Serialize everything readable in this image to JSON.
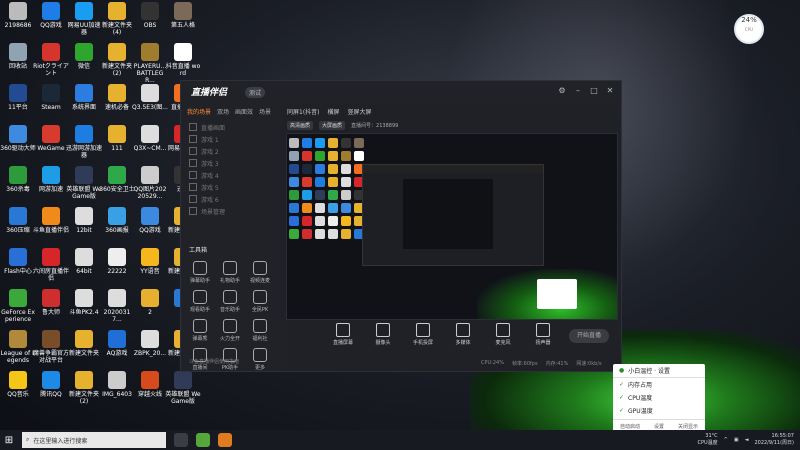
{
  "desktop": {
    "icons": [
      {
        "label": "2198686",
        "color": "#bbbbbb"
      },
      {
        "label": "QQ游戏",
        "color": "#1e7de6"
      },
      {
        "label": "网易UU加速器",
        "color": "#1a9cf0"
      },
      {
        "label": "新建文件夹 (4)",
        "color": "#e6b12e"
      },
      {
        "label": "OBS",
        "color": "#333333"
      },
      {
        "label": "第五人格",
        "color": "#7c6a58"
      },
      {
        "label": "回收站",
        "color": "#8fa3b3"
      },
      {
        "label": "Riotクライアント",
        "color": "#d8342e"
      },
      {
        "label": "微信",
        "color": "#2ea62e"
      },
      {
        "label": "新建文件夹 (2)",
        "color": "#e6b12e"
      },
      {
        "label": "PLAYERU... BATTLEGR...",
        "color": "#a07d2e"
      },
      {
        "label": "抖音直播 word",
        "color": "#ffffff"
      },
      {
        "label": "11平台",
        "color": "#224b91"
      },
      {
        "label": "Steam",
        "color": "#1b2838"
      },
      {
        "label": "系统界面",
        "color": "#2d7de0"
      },
      {
        "label": "速机必备",
        "color": "#e6b12e"
      },
      {
        "label": "Q3.5E3(图...",
        "color": "#dddddd"
      },
      {
        "label": "直播伴侣",
        "color": "#f36e21"
      },
      {
        "label": "360驱动大师",
        "color": "#3d8ae0"
      },
      {
        "label": "WeGame",
        "color": "#d63b2e"
      },
      {
        "label": "迅游网游加速器",
        "color": "#1d7de0"
      },
      {
        "label": "111",
        "color": "#e6b12e"
      },
      {
        "label": "Q3X~CM...",
        "color": "#dddddd"
      },
      {
        "label": "网易云音乐",
        "color": "#d6262a"
      },
      {
        "label": "360杀毒",
        "color": "#2d9a3b"
      },
      {
        "label": "网游加速",
        "color": "#1f9ce6"
      },
      {
        "label": "英雄联盟 WeGame版",
        "color": "#2f3b57"
      },
      {
        "label": "360安全卫士",
        "color": "#2fa84a"
      },
      {
        "label": "QQ图片20220529...",
        "color": "#cccccc"
      },
      {
        "label": "迅游",
        "color": "#333333"
      },
      {
        "label": "360压缩",
        "color": "#2a78d6"
      },
      {
        "label": "斗鱼直播伴侣",
        "color": "#f08a1b"
      },
      {
        "label": "12bit",
        "color": "#dddddd"
      },
      {
        "label": "360画报",
        "color": "#3aa0e6"
      },
      {
        "label": "QQ游戏",
        "color": "#3b8ae0"
      },
      {
        "label": "新建文件夹",
        "color": "#e6b12e"
      },
      {
        "label": "Flash中心",
        "color": "#2a6fd6"
      },
      {
        "label": "六间房直播伴侣",
        "color": "#d6262a"
      },
      {
        "label": "64bit",
        "color": "#dddddd"
      },
      {
        "label": "22222",
        "color": "#eeeeee"
      },
      {
        "label": "YY语音",
        "color": "#f5b71b"
      },
      {
        "label": "新建文件夹",
        "color": "#e6b12e"
      },
      {
        "label": "GeForce Experience",
        "color": "#3aa83a"
      },
      {
        "label": "鲁大师",
        "color": "#cf2e2e"
      },
      {
        "label": "斗鱼PK2.4",
        "color": "#dddddd"
      },
      {
        "label": "20200317...",
        "color": "#dddddd"
      },
      {
        "label": "2",
        "color": "#e6b12e"
      },
      {
        "label": "X",
        "color": "#2a78d6"
      },
      {
        "label": "League of Legends",
        "color": "#b08a3a"
      },
      {
        "label": "魔兽争霸官方对战平台",
        "color": "#7a4d2a"
      },
      {
        "label": "新建文件夹",
        "color": "#e6b12e"
      },
      {
        "label": "AQ游戏",
        "color": "#1f6fd6"
      },
      {
        "label": "ZBPK_20...",
        "color": "#dddddd"
      },
      {
        "label": "新建文件夹",
        "color": "#e6b12e"
      },
      {
        "label": "QQ音乐",
        "color": "#f5c518"
      },
      {
        "label": "腾讯QQ",
        "color": "#1d8ae6"
      },
      {
        "label": "新建文件夹 (2)",
        "color": "#e6b12e"
      },
      {
        "label": "IMG_6403",
        "color": "#cccccc"
      },
      {
        "label": "穿越火线",
        "color": "#d64a1b"
      },
      {
        "label": "英雄联盟 WeGame版",
        "color": "#2f3b57"
      }
    ]
  },
  "cpu_badge": {
    "value": "24%",
    "sub": "CPU"
  },
  "app": {
    "logo": "直播伴侣",
    "version": "测试",
    "left_tabs": [
      "我的场景",
      "双场",
      "画面效",
      "场景"
    ],
    "layers": [
      "直播画面",
      "游戏 1",
      "游戏 2",
      "游戏 3",
      "游戏 4",
      "游戏 5",
      "游戏 6",
      "场景管理"
    ],
    "tools_title": "工具箱",
    "tools": [
      "弹幕助手",
      "礼物助手",
      "视频连麦",
      "观看助手",
      "音乐助手",
      "全民PK",
      "弹幕秀",
      "火力全开",
      "福利社",
      "直播间",
      "PK助手",
      "更多"
    ],
    "lp_bottom": "斗鱼直播伴侣使用指南",
    "stage_header": [
      "同屏1(抖音)",
      "横屏",
      "竖屏大屏"
    ],
    "stage_sub": [
      "高清画质",
      "大屏画质",
      "直播间号：2138899"
    ],
    "bottom_tools": [
      "直播屏幕",
      "摄像头",
      "手机投屏",
      "多媒体",
      "麦克风",
      "扬声器"
    ],
    "start_live": "开始直播",
    "status": [
      "CPU:24%",
      "帧率:60fps",
      "内存:41%",
      "网速:0kb/s"
    ]
  },
  "tray_popup": {
    "title": "小白温控 · 设置",
    "items": [
      "内存占用",
      "CPU温度",
      "GPU温度"
    ],
    "footer": [
      "自动启动",
      "设置",
      "关闭显示"
    ]
  },
  "taskbar": {
    "search_placeholder": "在这里输入进行搜索",
    "weather": "31°C",
    "weather_desc": "CPU温度",
    "time": "16:55:07",
    "date": "2022/9/11(周日)"
  }
}
